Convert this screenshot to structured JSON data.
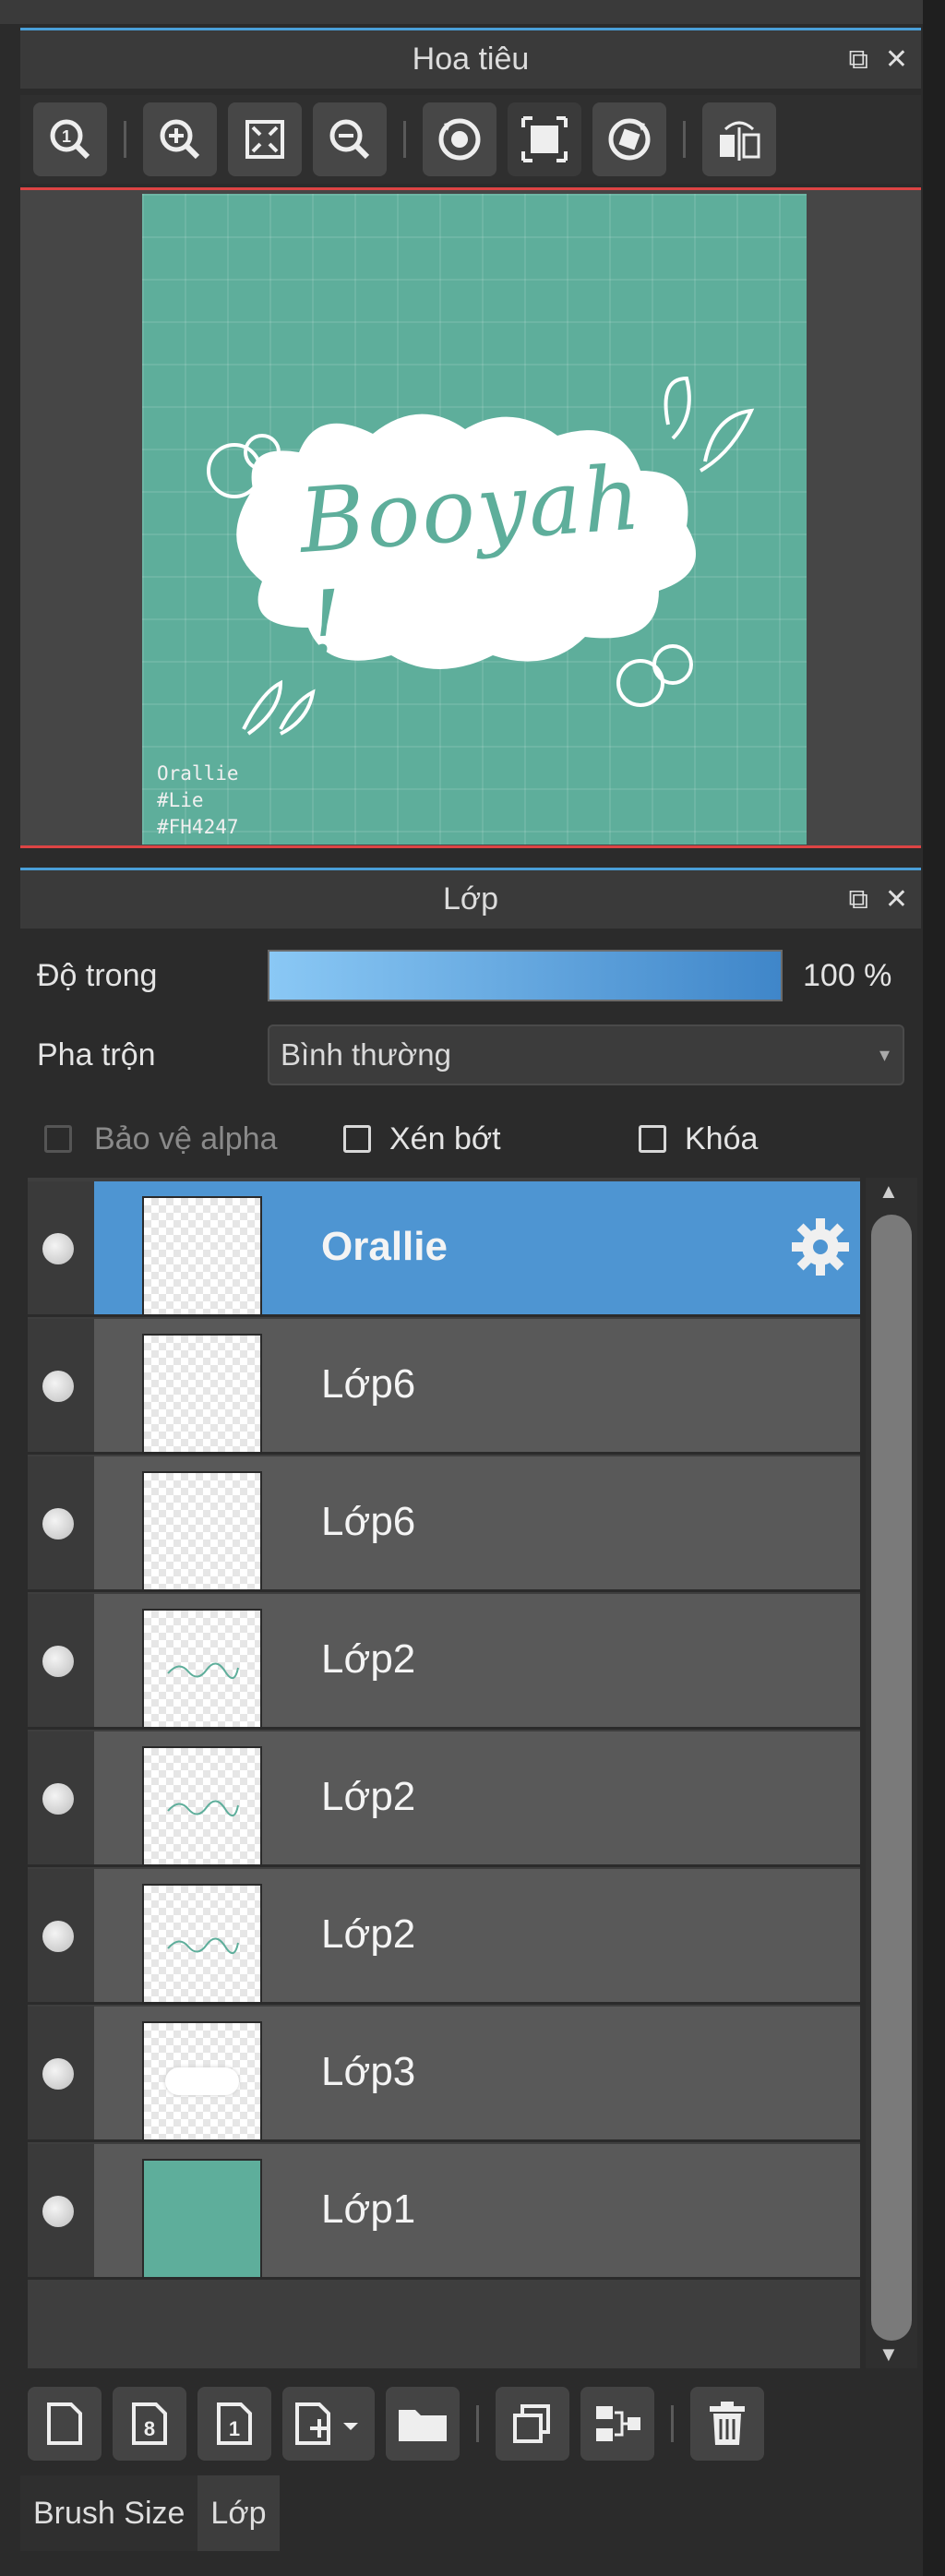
{
  "navigator": {
    "title": "Hoa tiêu",
    "detach_icon": "popout-icon",
    "close_icon": "close-icon",
    "tools": [
      "zoom-actual-icon",
      "zoom-in-icon",
      "fit-icon",
      "zoom-out-icon",
      "rotate-left-icon",
      "fullscreen-icon",
      "rotate-right-icon",
      "flip-icon"
    ],
    "canvas_text": "Booyah !",
    "signature": [
      "Orallie",
      "#Lie",
      "#FH4247"
    ],
    "canvas_color": "#5eae9b"
  },
  "layers": {
    "title": "Lớp",
    "opacity_label": "Độ trong",
    "opacity_value": "100 %",
    "opacity_level": 1.0,
    "blend_label": "Pha trộn",
    "blend_value": "Bình thường",
    "protect_alpha": "Bảo vệ alpha",
    "clipping": "Xén bớt",
    "lock": "Khóa",
    "rows": [
      {
        "name": "Orallie",
        "active": true,
        "thumb": "blank"
      },
      {
        "name": "Lớp6",
        "active": false,
        "thumb": "blank"
      },
      {
        "name": "Lớp6",
        "active": false,
        "thumb": "blank"
      },
      {
        "name": "Lớp2",
        "active": false,
        "thumb": "booyah"
      },
      {
        "name": "Lớp2",
        "active": false,
        "thumb": "booyah"
      },
      {
        "name": "Lớp2",
        "active": false,
        "thumb": "booyah"
      },
      {
        "name": "Lớp3",
        "active": false,
        "thumb": "cloud"
      },
      {
        "name": "Lớp1",
        "active": false,
        "thumb": "fill"
      }
    ]
  },
  "bottom_tools": [
    "new-layer-icon",
    "8bit-layer-icon",
    "1bit-layer-icon",
    "add-special-icon",
    "folder-icon",
    "duplicate-icon",
    "merge-icon",
    "trash-icon"
  ],
  "tabs": {
    "brush_size": "Brush Size",
    "layer": "Lớp"
  },
  "colors": {
    "accent": "#4e95d2",
    "active_row": "#4e95d2",
    "teal": "#5eae9b"
  }
}
